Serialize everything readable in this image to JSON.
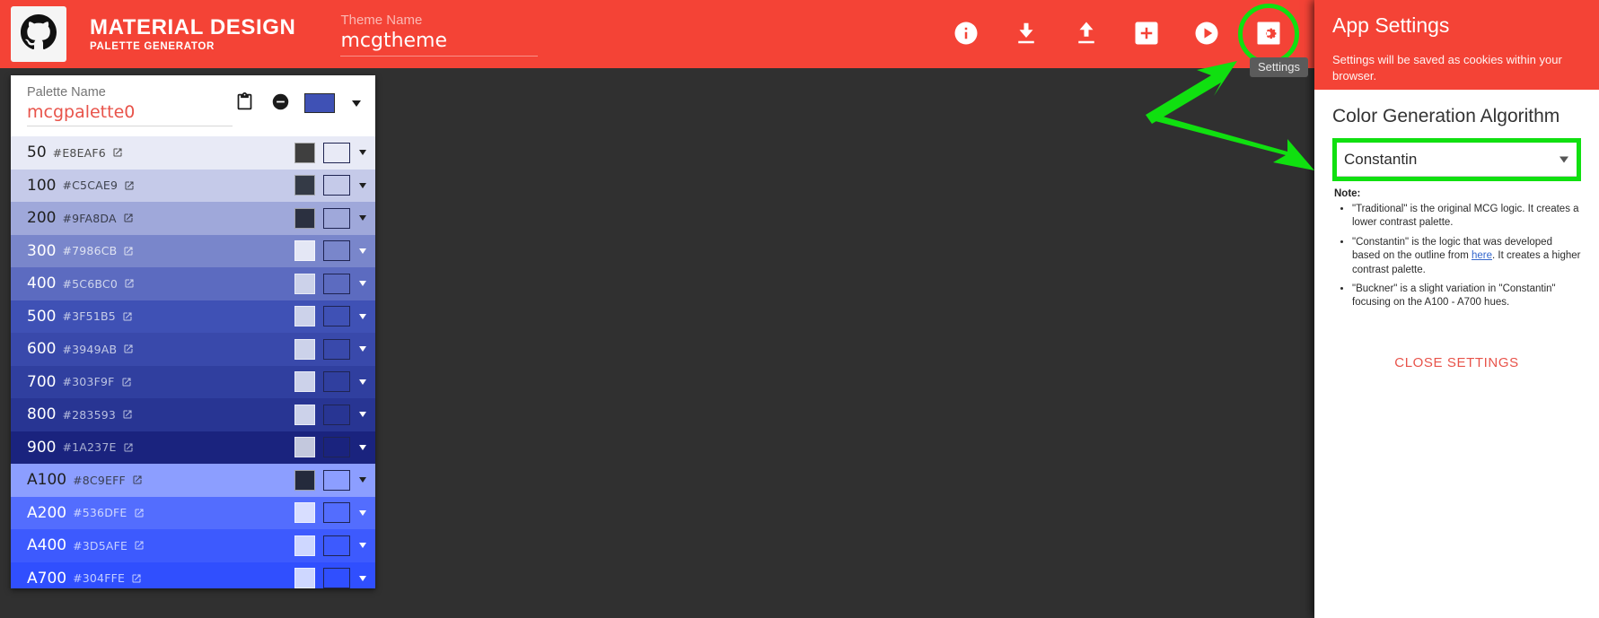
{
  "toolbar": {
    "logo_icon": "github-icon",
    "brand_title": "MATERIAL DESIGN",
    "brand_subtitle": "PALETTE GENERATOR",
    "theme_label": "Theme Name",
    "theme_value": "mcgtheme",
    "actions": [
      {
        "name": "about-button",
        "icon": "info-icon"
      },
      {
        "name": "download-button",
        "icon": "download-icon"
      },
      {
        "name": "upload-button",
        "icon": "upload-icon"
      },
      {
        "name": "add-palette-button",
        "icon": "plus-box-icon"
      },
      {
        "name": "preview-button",
        "icon": "play-circle-icon"
      },
      {
        "name": "settings-button",
        "icon": "gear-box-icon"
      }
    ],
    "tooltip": "Settings"
  },
  "palette": {
    "name_label": "Palette Name",
    "name_value": "mcgpalette0",
    "copy_icon": "clipboard-icon",
    "remove_icon": "minus-circle-icon",
    "base_color": "#3F51B5",
    "link_icon": "external-link-icon",
    "rows": [
      {
        "name": "50",
        "hex": "#E8EAF6",
        "bg": "#E8EAF6",
        "fg": "#1f1f1f",
        "text_swatch": "#3f3f3f",
        "hex_fg": "#4a4a4a"
      },
      {
        "name": "100",
        "hex": "#C5CAE9",
        "bg": "#C5CAE9",
        "fg": "#1f1f1f",
        "text_swatch": "#343a46",
        "hex_fg": "#40444f"
      },
      {
        "name": "200",
        "hex": "#9FA8DA",
        "bg": "#9FA8DA",
        "fg": "#1f1f1f",
        "text_swatch": "#2b3040",
        "hex_fg": "#383c4c"
      },
      {
        "name": "300",
        "hex": "#7986CB",
        "bg": "#7986CB",
        "fg": "#ffffff",
        "text_swatch": "#e4e7f5",
        "hex_fg": "#dfe3f2"
      },
      {
        "name": "400",
        "hex": "#5C6BC0",
        "bg": "#5C6BC0",
        "fg": "#ffffff",
        "text_swatch": "#ccd2ea",
        "hex_fg": "#cfd5ec"
      },
      {
        "name": "500",
        "hex": "#3F51B5",
        "bg": "#3F51B5",
        "fg": "#ffffff",
        "text_swatch": "#ccd2ea",
        "hex_fg": "#c7cde8"
      },
      {
        "name": "600",
        "hex": "#3949AB",
        "bg": "#3949AB",
        "fg": "#ffffff",
        "text_swatch": "#ccd2ea",
        "hex_fg": "#c4cae6"
      },
      {
        "name": "700",
        "hex": "#303F9F",
        "bg": "#303F9F",
        "fg": "#ffffff",
        "text_swatch": "#ccd2ea",
        "hex_fg": "#bcc3e2"
      },
      {
        "name": "800",
        "hex": "#283593",
        "bg": "#283593",
        "fg": "#ffffff",
        "text_swatch": "#ccd2ea",
        "hex_fg": "#b8bfe0"
      },
      {
        "name": "900",
        "hex": "#1A237E",
        "bg": "#1A237E",
        "fg": "#ffffff",
        "text_swatch": "#c3c8dd",
        "hex_fg": "#a9b0d2"
      },
      {
        "name": "A100",
        "hex": "#8C9EFF",
        "bg": "#8C9EFF",
        "fg": "#1f1f1f",
        "text_swatch": "#242a3c",
        "hex_fg": "#3a3f52"
      },
      {
        "name": "A200",
        "hex": "#536DFE",
        "bg": "#536DFE",
        "fg": "#ffffff",
        "text_swatch": "#d8deff",
        "hex_fg": "#cfd7ff"
      },
      {
        "name": "A400",
        "hex": "#3D5AFE",
        "bg": "#3D5AFE",
        "fg": "#ffffff",
        "text_swatch": "#ced7ff",
        "hex_fg": "#c6d0ff"
      },
      {
        "name": "A700",
        "hex": "#304FFE",
        "bg": "#304FFE",
        "fg": "#ffffff",
        "text_swatch": "#ced7ff",
        "hex_fg": "#c3ceff"
      }
    ]
  },
  "settings": {
    "title": "App Settings",
    "subtitle": "Settings will be saved as cookies within your browser.",
    "section_title": "Color Generation Algorithm",
    "selected_algorithm": "Constantin",
    "algorithm_options": [
      "Traditional",
      "Constantin",
      "Buckner"
    ],
    "note_label": "Note:",
    "notes": [
      {
        "before": "\"Traditional\" is the original MCG logic. It creates a lower contrast palette.",
        "link": "",
        "after": ""
      },
      {
        "before": "\"Constantin\" is the logic that was developed based on the outline from ",
        "link": "here",
        "after": ". It creates a higher contrast palette."
      },
      {
        "before": "\"Buckner\" is a slight variation in \"Constantin\" focusing on the A100 - A700 hues.",
        "link": "",
        "after": ""
      }
    ],
    "close_label": "CLOSE SETTINGS"
  },
  "annotations": {
    "highlight_color": "#10E010",
    "arrow_to_settings": "points up-right at settings gear button",
    "arrow_to_dropdown": "points right at color generation algorithm dropdown"
  },
  "theme": {
    "accent_red": "#F44336",
    "background_dark": "#303030",
    "highlight_green": "#10E010"
  }
}
